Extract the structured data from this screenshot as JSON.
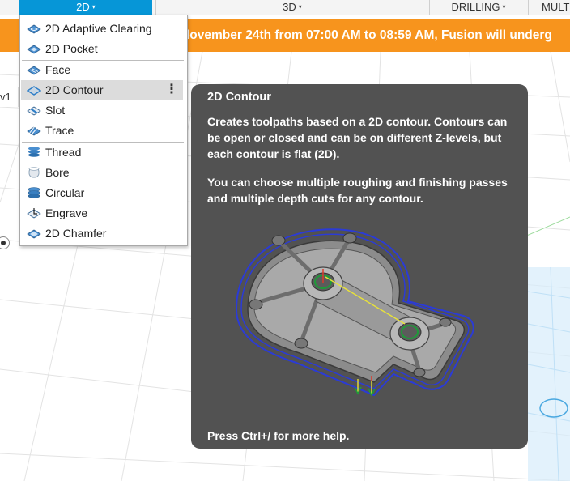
{
  "toolbar": {
    "tabs": [
      {
        "label": "2D",
        "active": true
      },
      {
        "label": "3D",
        "active": false
      },
      {
        "label": "DRILLING",
        "active": false
      },
      {
        "label": "MULT",
        "active": false
      }
    ],
    "caret": "▾",
    "accent": "#0696d7"
  },
  "banner": {
    "text": "lovember 24th from 07:00 AM to 08:59 AM, Fusion will underg",
    "color": "#f7941d"
  },
  "browser_stub": {
    "label": "v1"
  },
  "menu": {
    "items": [
      {
        "label": "2D Adaptive Clearing",
        "icon": "adaptive-clearing-icon"
      },
      {
        "label": "2D Pocket",
        "icon": "pocket-icon"
      },
      {
        "label": "Face",
        "icon": "face-icon"
      },
      {
        "label": "2D Contour",
        "icon": "contour-icon",
        "highlighted": true
      },
      {
        "label": "Slot",
        "icon": "slot-icon"
      },
      {
        "label": "Trace",
        "icon": "trace-icon"
      },
      {
        "label": "Thread",
        "icon": "thread-icon"
      },
      {
        "label": "Bore",
        "icon": "bore-icon"
      },
      {
        "label": "Circular",
        "icon": "circular-icon"
      },
      {
        "label": "Engrave",
        "icon": "engrave-icon"
      },
      {
        "label": "2D Chamfer",
        "icon": "chamfer-icon"
      }
    ],
    "more_glyph": "⋮"
  },
  "tooltip": {
    "title": "2D Contour",
    "paragraph1": "Creates toolpaths based on a 2D contour. Contours can be open or closed and can be on different Z-levels, but each contour is flat (2D).",
    "paragraph2": "You can choose multiple roughing and finishing passes and multiple depth cuts for any contour.",
    "footer": "Press Ctrl+/ for more help.",
    "background": "#525252"
  }
}
